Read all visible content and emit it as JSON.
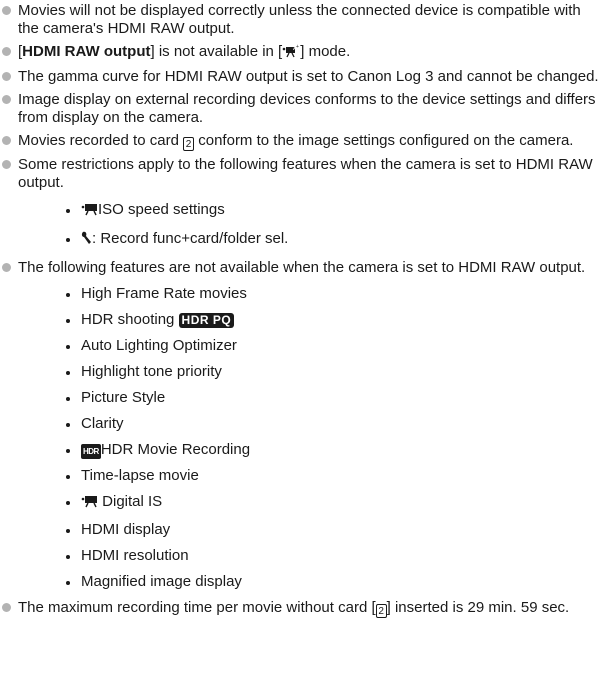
{
  "notes": {
    "n1": "Movies will not be displayed correctly unless the connected device is compatible with the camera's HDMI RAW output.",
    "n2_pre": "[",
    "n2_bold": "HDMI RAW output",
    "n2_mid": "] is not available in [",
    "n2_post": "] mode.",
    "n3": "The gamma curve for HDMI RAW output is set to Canon Log 3 and cannot be changed.",
    "n4": "Image display on external recording devices conforms to the device settings and differs from display on the camera.",
    "n5_pre": "Movies recorded to card ",
    "n5_post": " conform to the image settings configured on the camera.",
    "n6": "Some restrictions apply to the following features when the camera is set to HDMI RAW output.",
    "n6_items": [
      "ISO speed settings",
      ": Record func+card/folder sel."
    ],
    "n7": "The following features are not available when the camera is set to HDMI RAW output.",
    "n7_items": [
      "High Frame Rate movies",
      "HDR shooting ",
      "Auto Lighting Optimizer",
      "Highlight tone priority",
      "Picture Style",
      "Clarity",
      "HDR Movie Recording",
      "Time-lapse movie",
      " Digital IS",
      "HDMI display",
      "HDMI resolution",
      "Magnified image display"
    ],
    "n8_pre": "The maximum recording time per movie without card [",
    "n8_post": "] inserted is 29 min. 59 sec.",
    "card_number": "2",
    "hdr_pq_label": "HDR PQ",
    "hdr_movie_label": "HDR"
  },
  "icons": {
    "bullet": "bullet-dot-icon",
    "movie_auto": "movie-auto-icon",
    "movie_camera": "movie-camera-icon",
    "wrench": "wrench-icon",
    "card": "card-slot-icon"
  }
}
